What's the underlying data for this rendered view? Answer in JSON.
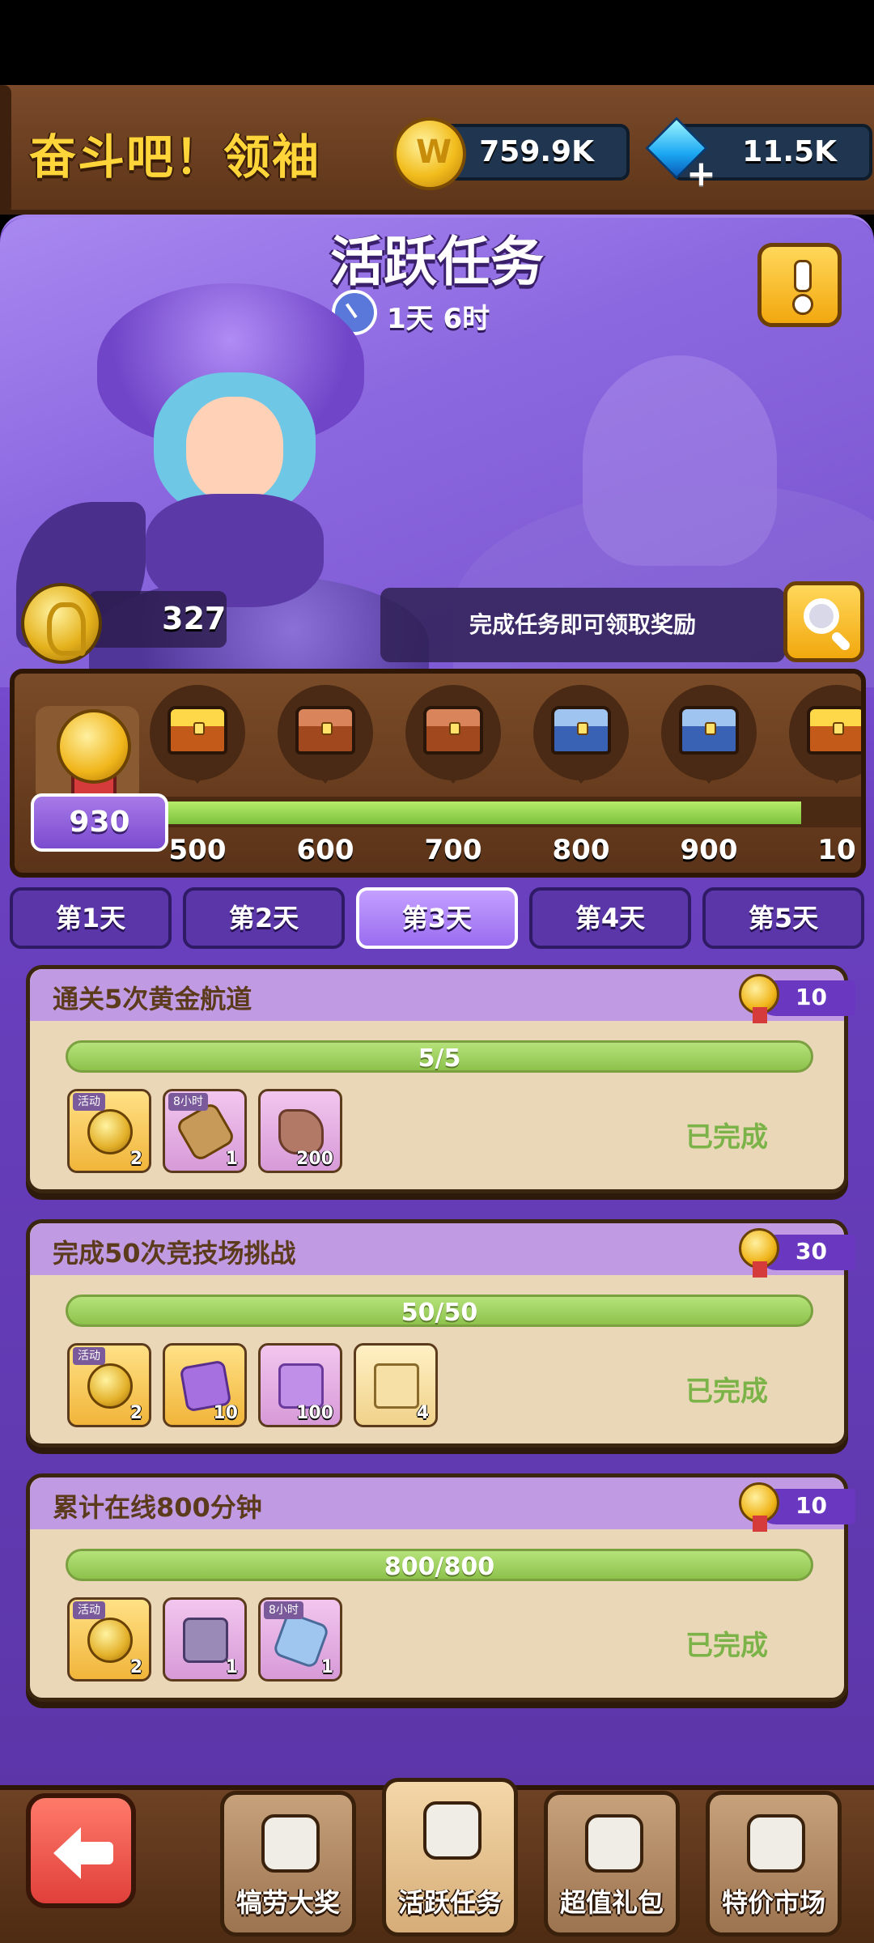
{
  "header": {
    "game_title": "奋斗吧！领袖",
    "gold": "759.9K",
    "gems": "11.5K"
  },
  "event": {
    "title": "活跃任务",
    "countdown": "1天 6时",
    "points": "327",
    "hint": "完成任务即可领取奖励",
    "current_score": "930",
    "progress_fraction": 0.9,
    "milestones": [
      {
        "value": "500",
        "chest": "gold"
      },
      {
        "value": "600",
        "chest": "bronze"
      },
      {
        "value": "700",
        "chest": "bronze"
      },
      {
        "value": "800",
        "chest": "blue"
      },
      {
        "value": "900",
        "chest": "blue"
      },
      {
        "value": "10",
        "chest": "gold"
      }
    ]
  },
  "tabs": [
    "第1天",
    "第2天",
    "第3天",
    "第4天",
    "第5天"
  ],
  "active_tab": 2,
  "tasks": [
    {
      "title": "通关5次黄金航道",
      "reward": "10",
      "progress": "5/5",
      "status": "已完成",
      "items": [
        {
          "tag": "活动",
          "qty": "2",
          "icon": "coin-icon"
        },
        {
          "tag": "8小时",
          "qty": "1",
          "icon": "log-icon"
        },
        {
          "tag": "",
          "qty": "200",
          "icon": "ore-icon"
        }
      ]
    },
    {
      "title": "完成50次竞技场挑战",
      "reward": "30",
      "progress": "50/50",
      "status": "已完成",
      "items": [
        {
          "tag": "活动",
          "qty": "2",
          "icon": "coin-icon"
        },
        {
          "tag": "",
          "qty": "10",
          "icon": "puzzle-icon"
        },
        {
          "tag": "",
          "qty": "100",
          "icon": "shirt-icon"
        },
        {
          "tag": "",
          "qty": "4",
          "icon": "scroll-icon"
        }
      ]
    },
    {
      "title": "累计在线800分钟",
      "reward": "10",
      "progress": "800/800",
      "status": "已完成",
      "items": [
        {
          "tag": "活动",
          "qty": "2",
          "icon": "coin-icon"
        },
        {
          "tag": "",
          "qty": "1",
          "icon": "chest-icon"
        },
        {
          "tag": "8小时",
          "qty": "1",
          "icon": "crystal-icon"
        }
      ]
    }
  ],
  "bottom_nav": {
    "back": "back-arrow-icon",
    "items": [
      "犒劳大奖",
      "活跃任务",
      "超值礼包",
      "特价市场"
    ],
    "active": 1
  }
}
